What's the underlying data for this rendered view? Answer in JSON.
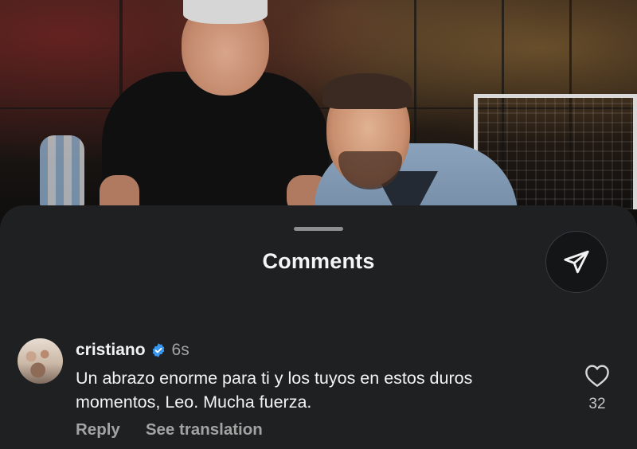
{
  "sheet": {
    "title": "Comments"
  },
  "icons": {
    "share": "share-icon",
    "verified": "verified-badge-icon",
    "like": "heart-icon"
  },
  "colors": {
    "sheet_background": "#1e2022",
    "verified_blue": "#3897f0",
    "secondary_text": "#a3a3a3"
  },
  "comment": {
    "username": "cristiano",
    "time": "6s",
    "text": "Un abrazo enorme para ti y los tuyos en estos duros momentos, Leo. Mucha fuerza.",
    "like_count": "32",
    "reply_label": "Reply",
    "translate_label": "See translation"
  }
}
